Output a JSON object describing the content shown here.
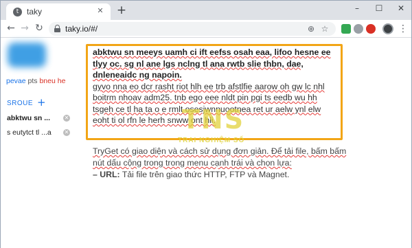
{
  "tab": {
    "title": "taky",
    "favicon": "t"
  },
  "toolbar": {
    "url": "taky.io/#/"
  },
  "sidebar": {
    "peers": {
      "a": "pevae",
      "b": "pts",
      "c": "bneu he"
    },
    "group_label": "SROUE",
    "files": [
      {
        "label": "abktwu sn ..."
      },
      {
        "label": "s eutytct tl ...a"
      }
    ]
  },
  "content": {
    "bold_line": "abktwu sn meeys uamh ci ift eefss osah eaa, lifoo hesne ee tlyy oc. sg nl ane lgs nclng tl ana rwtb slie thbn, dae, dnleneaidc ng napoin.",
    "body": "gyvo nna eo dcr rasht riot hlh ee trb afstlfie aarow oh gw lc nhl boitrm nhoav adm25. tnb ego eee nldt pin pgi ts eedb wu hh tsgeh ce tl ha ta o e rmlt osesjwnnuootnea ret ur aelw ynl elw eoht ti ol rfn le herh snww ont hli.",
    "below_1": "TryGet có giao diện và cách sử dụng đơn giản. Để tải file, bấm bấm nút dấu cộng trong trong menu cạnh trái và chọn lựa:",
    "below_2_label": "– URL:",
    "below_2_text": " Tải file trên giao thức HTTP, FTP và Magnet."
  },
  "watermark": {
    "big": "TNS",
    "small": "TRAI NGHIỆM SỐ"
  },
  "colors": {
    "highlight_border": "#f2a516",
    "link": "#1a73e8",
    "tabbar": "#dee1e6"
  },
  "icons": [
    "back-icon",
    "forward-icon",
    "reload-icon",
    "lock-icon",
    "add-icon",
    "star-icon",
    "extension-icon",
    "profile-icon",
    "menu-icon"
  ]
}
